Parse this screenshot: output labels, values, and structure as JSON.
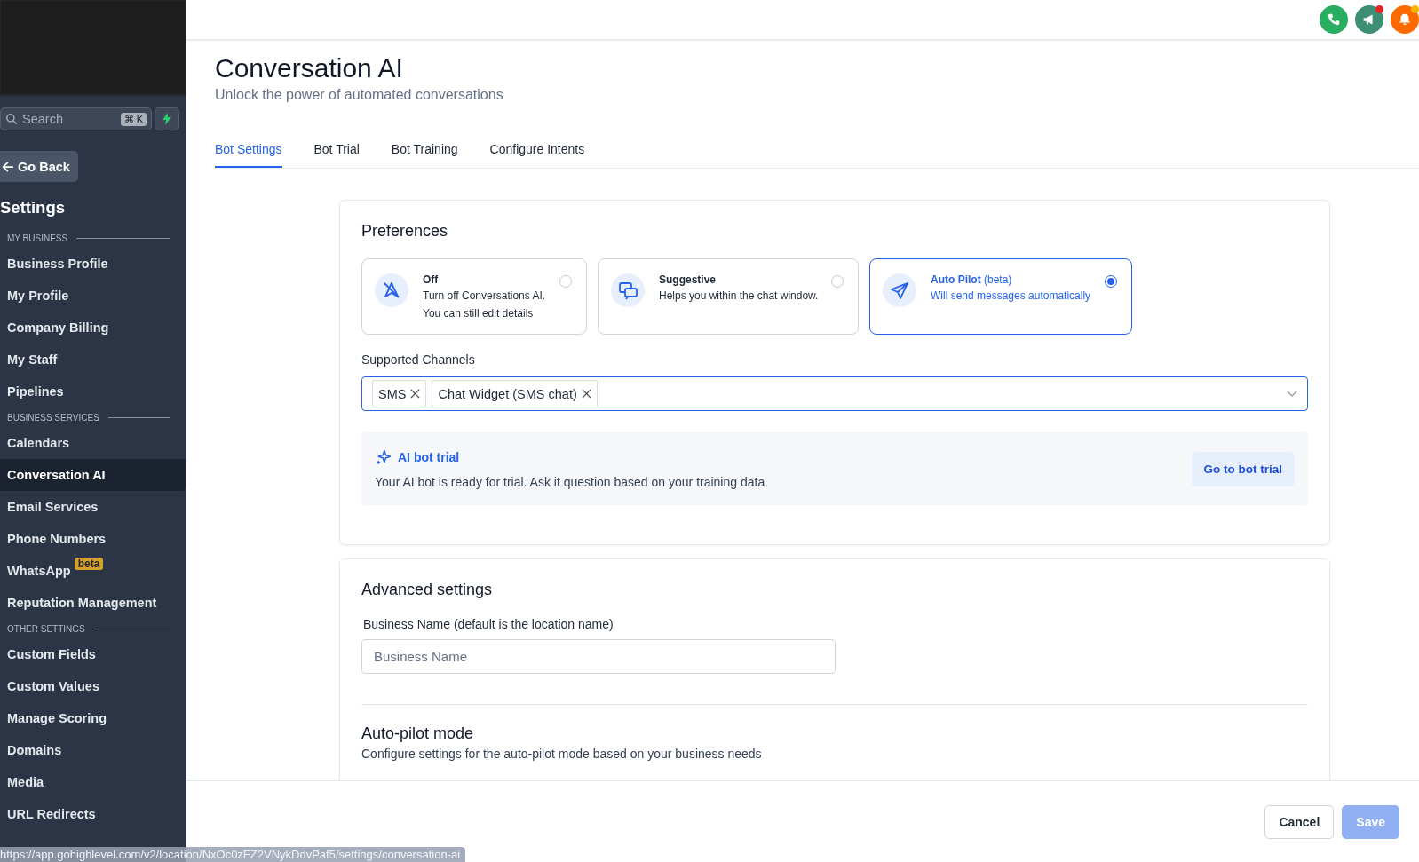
{
  "sidebar": {
    "search": {
      "placeholder": "Search",
      "shortcut": "⌘ K"
    },
    "back_button": "Go Back",
    "title": "Settings",
    "sections": [
      {
        "heading": "MY BUSINESS",
        "items": [
          {
            "label": "Business Profile",
            "selected": false
          },
          {
            "label": "My Profile",
            "selected": false
          },
          {
            "label": "Company Billing",
            "selected": false
          },
          {
            "label": "My Staff",
            "selected": false
          },
          {
            "label": "Pipelines",
            "selected": false
          }
        ]
      },
      {
        "heading": "BUSINESS SERVICES",
        "items": [
          {
            "label": "Calendars",
            "selected": false
          },
          {
            "label": "Conversation AI",
            "selected": true
          },
          {
            "label": "Email Services",
            "selected": false
          },
          {
            "label": "Phone Numbers",
            "selected": false
          },
          {
            "label": "WhatsApp",
            "badge": "beta",
            "selected": false
          },
          {
            "label": "Reputation Management",
            "selected": false
          }
        ]
      },
      {
        "heading": "OTHER SETTINGS",
        "items": [
          {
            "label": "Custom Fields",
            "selected": false
          },
          {
            "label": "Custom Values",
            "selected": false
          },
          {
            "label": "Manage Scoring",
            "selected": false
          },
          {
            "label": "Domains",
            "selected": false
          },
          {
            "label": "Media",
            "selected": false
          },
          {
            "label": "URL Redirects",
            "selected": false
          }
        ]
      }
    ]
  },
  "page": {
    "title": "Conversation AI",
    "subtitle": "Unlock the power of automated conversations",
    "tabs": [
      {
        "label": "Bot Settings",
        "selected": true
      },
      {
        "label": "Bot Trial",
        "selected": false
      },
      {
        "label": "Bot Training",
        "selected": false
      },
      {
        "label": "Configure Intents",
        "selected": false
      }
    ]
  },
  "preferences": {
    "title": "Preferences",
    "options": [
      {
        "kind": "off",
        "title": "Off",
        "description": [
          "Turn off Conversations AI.",
          "You can still edit details"
        ],
        "selected": false
      },
      {
        "kind": "suggestive",
        "title": "Suggestive",
        "description": [
          "Helps you within the chat window."
        ],
        "selected": false
      },
      {
        "kind": "autopilot",
        "title": "Auto Pilot",
        "tag": "(beta)",
        "description": [
          "Will send messages automatically"
        ],
        "selected": true
      }
    ],
    "channels_label": "Supported Channels",
    "channels": [
      "SMS",
      "Chat Widget (SMS chat)"
    ],
    "trial": {
      "title": "AI bot trial",
      "text": "Your AI bot is ready for trial. Ask it question based on your training data",
      "button": "Go to bot trial"
    }
  },
  "advanced": {
    "title": "Advanced settings",
    "field_label": "Business Name (default is the location name)",
    "placeholder": "Business Name",
    "autopilot_title": "Auto-pilot mode",
    "autopilot_text": "Configure settings for the auto-pilot mode based on your business needs"
  },
  "footer": {
    "buttons": [
      {
        "label": "Cancel",
        "kind": "secondary",
        "disabled": false
      },
      {
        "label": "Save",
        "kind": "primary",
        "disabled": true
      }
    ]
  },
  "status_url": "https://app.gohighlevel.com/v2/location/NxOc0zFZ2VNykDdvPaf5/settings/conversation-ai"
}
